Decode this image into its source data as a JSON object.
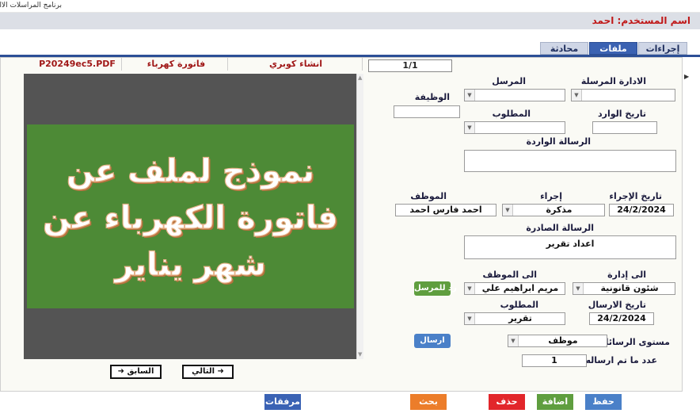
{
  "window": {
    "title": "برنامج المراسلات الالكترو"
  },
  "user": {
    "label": "اسم المستخدم: احمد"
  },
  "tabs": [
    {
      "label": "إجراءات",
      "active": false
    },
    {
      "label": "ملفات",
      "active": true
    },
    {
      "label": "محادثة",
      "active": false
    }
  ],
  "file_header": {
    "filename": "P20249ec5.PDF",
    "file_title": "فاتورة كهرباء",
    "file_desc": "انشاء كوبري",
    "pager": "1/1"
  },
  "document": {
    "lines": [
      "نموذج لملف عن",
      "فاتورة الكهرباء عن",
      "شهر يناير"
    ]
  },
  "nav": {
    "prev": "السابق ➜",
    "next": "➜ التالي"
  },
  "form": {
    "sender_dept": {
      "label": "الادارة المرسلة",
      "value": ""
    },
    "sender": {
      "label": "المرسل",
      "value": ""
    },
    "job": {
      "label": "الوظيفة",
      "value": ""
    },
    "incoming_date": {
      "label": "تاريخ الوارد",
      "value": ""
    },
    "required_in": {
      "label": "المطلوب",
      "value": ""
    },
    "incoming_msg": {
      "label": "الرسالة الواردة",
      "value": ""
    },
    "action_date": {
      "label": "تاريخ الإجراء",
      "value": "24/2/2024"
    },
    "action": {
      "label": "إجراء",
      "value": "مذكرة"
    },
    "employee": {
      "label": "الموظف",
      "value": "احمد فارس احمد"
    },
    "outgoing_msg": {
      "label": "الرسالة الصادرة",
      "value": "اعداد تقرير"
    },
    "to_dept": {
      "label": "الى إدارة",
      "value": "شئون قانونية"
    },
    "to_employee": {
      "label": "الى الموظف",
      "value": "مريم ابراهيم علي"
    },
    "reply_btn": "رد للمرسل",
    "send_date": {
      "label": "تاريخ الارسال",
      "value": "24/2/2024"
    },
    "required_out": {
      "label": "المطلوب",
      "value": "تقرير"
    },
    "level": {
      "label": "مستوى الرسائل",
      "value": "موظف"
    },
    "send_btn": "ارسال",
    "sent_count": {
      "label": "عدد ما تم ارساله",
      "value": "1"
    }
  },
  "footer": {
    "attachments": "مرفقات",
    "search": "بحث",
    "delete": "حذف",
    "add": "اضافة",
    "save": "حفظ"
  },
  "colors": {
    "tab_active": "#3b62b2",
    "green": "#5f9e3f",
    "blue_btn": "#4a80c8",
    "orange": "#ec7d2a",
    "red": "#e2262b",
    "label_red": "#a01818"
  }
}
